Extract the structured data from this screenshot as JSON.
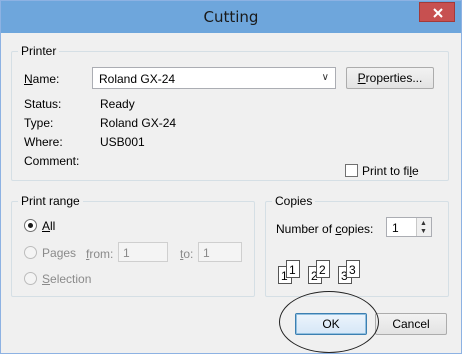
{
  "window": {
    "title": "Cutting"
  },
  "printer": {
    "legend": "Printer",
    "name_label": "Name:",
    "name_value": "Roland GX-24",
    "properties_label": "Properties...",
    "status_label": "Status:",
    "status_value": "Ready",
    "type_label": "Type:",
    "type_value": "Roland GX-24",
    "where_label": "Where:",
    "where_value": "USB001",
    "comment_label": "Comment:",
    "print_to_file_label": "Print to file"
  },
  "print_range": {
    "legend": "Print range",
    "all_label": "All",
    "pages_label": "Pages",
    "from_label": "from:",
    "from_value": "1",
    "to_label": "to:",
    "to_value": "1",
    "selection_label": "Selection"
  },
  "copies": {
    "legend": "Copies",
    "number_label": "Number of copies:",
    "number_value": "1",
    "collate_pages": [
      "1",
      "1",
      "2",
      "2",
      "3",
      "3"
    ]
  },
  "buttons": {
    "ok_label": "OK",
    "cancel_label": "Cancel"
  },
  "colors": {
    "titlebar": "#6ea6dc",
    "close": "#c75050",
    "default_button_border": "#3c7fb1"
  }
}
